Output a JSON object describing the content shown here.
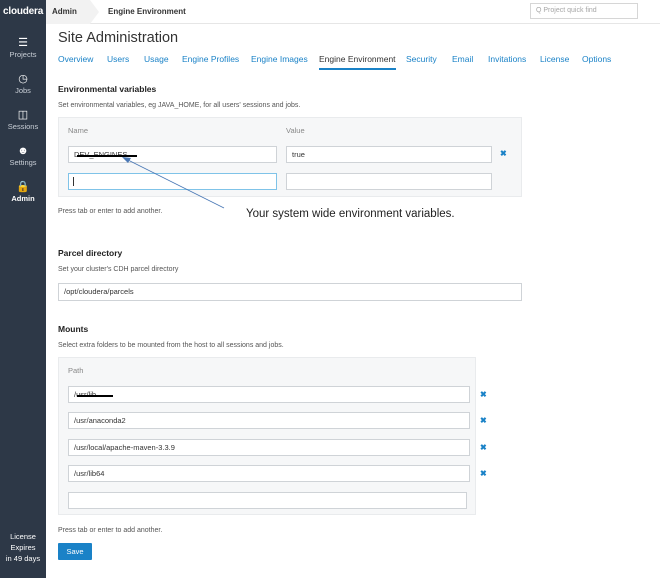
{
  "sidebar": {
    "brand": "cloudera",
    "items": [
      {
        "label": "Projects",
        "icon": "list-icon"
      },
      {
        "label": "Jobs",
        "icon": "clock-icon"
      },
      {
        "label": "Sessions",
        "icon": "window-icon"
      },
      {
        "label": "Settings",
        "icon": "user-icon"
      },
      {
        "label": "Admin",
        "icon": "lock-icon"
      }
    ],
    "license_line1": "License",
    "license_line2": "Expires",
    "license_line3": "in 49 days"
  },
  "topbar": {
    "crumb_admin": "Admin",
    "crumb_env": "Engine Environment",
    "search_placeholder": "Q  Project quick find"
  },
  "page": {
    "title": "Site Administration",
    "tabs": [
      "Overview",
      "Users",
      "Usage",
      "Engine Profiles",
      "Engine Images",
      "Engine Environment",
      "Security",
      "Email",
      "Invitations",
      "License",
      "Options"
    ],
    "active_tab": "Engine Environment"
  },
  "env": {
    "heading": "Environmental variables",
    "description": "Set environmental variables, eg JAVA_HOME, for all users' sessions and jobs.",
    "col_name": "Name",
    "col_value": "Value",
    "rows": [
      {
        "name": "DEV_ENGINES",
        "value": "true"
      }
    ],
    "hint": "Press tab or enter to add another."
  },
  "annotation": "Your system wide environment variables.",
  "parcel": {
    "heading": "Parcel directory",
    "description": "Set your cluster's CDH parcel directory",
    "value": "/opt/cloudera/parcels"
  },
  "mounts": {
    "heading": "Mounts",
    "description": "Select extra folders to be mounted from the host to all sessions and jobs.",
    "col_path": "Path",
    "rows": [
      "/usr/lib",
      "/usr/anaconda2",
      "/usr/local/apache-maven-3.3.9",
      "/usr/lib64"
    ],
    "hint": "Press tab or enter to add another."
  },
  "save_label": "Save",
  "colors": {
    "sidebar": "#2d3847",
    "accent": "#1a82c7"
  }
}
